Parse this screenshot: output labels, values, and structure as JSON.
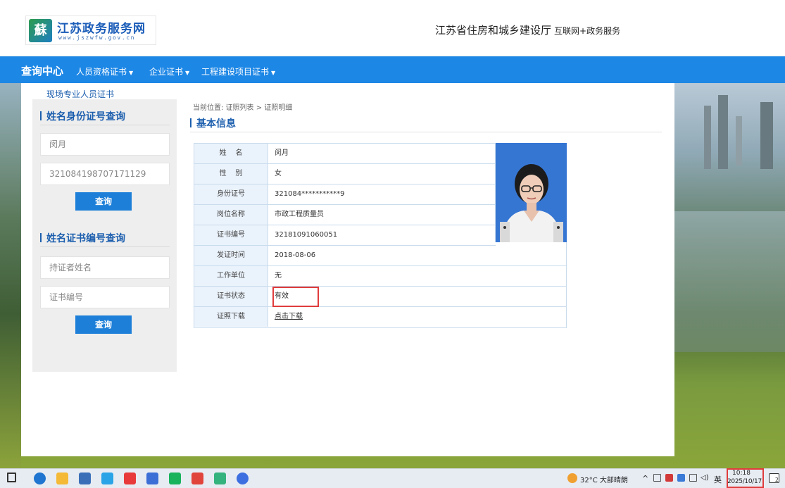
{
  "header": {
    "logo_glyph": "蘇",
    "site_title": "江苏政务服务网",
    "site_url": "www.jszwfw.gov.cn",
    "department": "江苏省住房和城乡建设厅",
    "department_sub": "互联网+政务服务"
  },
  "nav": {
    "home": "查询中心",
    "items": [
      {
        "label": "人员资格证书",
        "icon": "caret-down-icon"
      },
      {
        "label": "企业证书",
        "icon": "caret-down-icon"
      },
      {
        "label": "工程建设项目证书",
        "icon": "caret-down-icon"
      }
    ]
  },
  "sidebar": {
    "category": "现场专业人员证书",
    "id_search": {
      "title": "姓名身份证号查询",
      "name_value": "闵月",
      "id_value": "321084198707171129",
      "button": "查询"
    },
    "cert_search": {
      "title": "姓名证书编号查询",
      "name_placeholder": "持证者姓名",
      "cert_placeholder": "证书编号",
      "button": "查询"
    }
  },
  "content": {
    "breadcrumb": "当前位置:  证照列表 > 证照明细",
    "section_title": "基本信息",
    "rows": [
      {
        "label": "姓    名",
        "value": "闵月"
      },
      {
        "label": "性    别",
        "value": "女"
      },
      {
        "label": "身份证号",
        "value": "321084***********9"
      },
      {
        "label": "岗位名称",
        "value": "市政工程质量员"
      },
      {
        "label": "证书编号",
        "value": "32181091060051"
      },
      {
        "label": "发证时间",
        "value": "2018-08-06"
      },
      {
        "label": "工作单位",
        "value": "无"
      },
      {
        "label": "证书状态",
        "value": "有效"
      },
      {
        "label": "证照下载",
        "value": "点击下载"
      }
    ]
  },
  "taskbar": {
    "weather": "32°C 大部晴朗",
    "ime": "英",
    "time": "10:18",
    "date": "2025/10/17",
    "notification_count": "2"
  },
  "colors": {
    "nav_blue": "#1d87e6",
    "title_blue": "#1d5fae",
    "button_blue": "#1d7fd8",
    "highlight_red": "#e03c3c"
  }
}
